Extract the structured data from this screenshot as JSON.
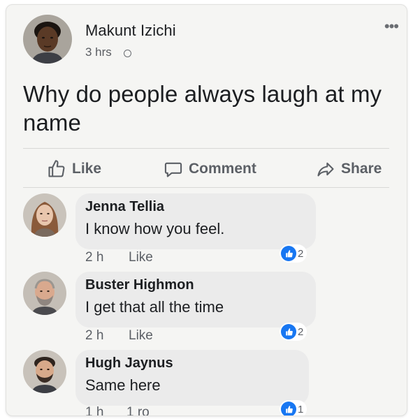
{
  "post": {
    "author": "Makunt Izichi",
    "time": "3 hrs",
    "text": "Why do people always laugh at my name",
    "more": "•••"
  },
  "actions": {
    "like": "Like",
    "comment": "Comment",
    "share": "Share"
  },
  "comments": [
    {
      "author": "Jenna Tellia",
      "text": "I know how you feel.",
      "time": "2 h",
      "action": "Like",
      "reactions": "2"
    },
    {
      "author": "Buster Highmon",
      "text": "I get that all the time",
      "time": "2 h",
      "action": "Like",
      "reactions": "2"
    },
    {
      "author": "Hugh Jaynus",
      "text": "Same here",
      "time": "1 h",
      "action": "1 ro",
      "reactions": "1"
    }
  ],
  "colors": {
    "accent": "#1877f2",
    "card": "#f5f5f3",
    "bubble": "#ebebeb",
    "muted": "#5c6066"
  },
  "icons": {
    "globe": "globe-icon",
    "more": "more-icon",
    "like": "thumbs-up-icon",
    "comment": "speech-bubble-icon",
    "share": "share-arrow-icon"
  }
}
